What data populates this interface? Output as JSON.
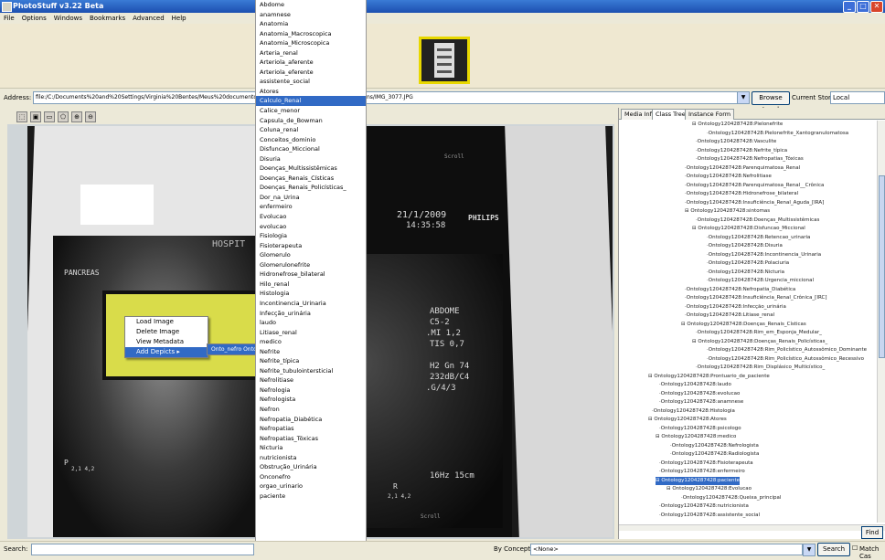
{
  "window": {
    "title": "PhotoStuff v3.22 Beta",
    "controls": [
      "_",
      "□",
      "✕"
    ]
  },
  "menu": [
    "File",
    "Options",
    "Windows",
    "Bookmarks",
    "Advanced",
    "Help"
  ],
  "address": {
    "label": "Address:",
    "value": "file:/C:/Documents%20and%20Settings/Virginia%20Bentes/Meus%20documentos/",
    "value_tail": "ns/IMG_3077.JPG",
    "browse_label": "Browse Local",
    "current_store_label": "Current Store:",
    "current_store_value": "Local"
  },
  "toolbar_icons": [
    "select-tool-icon",
    "image-tool-icon",
    "rect-tool-icon",
    "poly-tool-icon",
    "zoom-in-icon",
    "zoom-out-icon"
  ],
  "toolbar_glyphs": [
    "⬚",
    "▣",
    "▭",
    "⬠",
    "⊕",
    "⊖"
  ],
  "image_text": {
    "hospital": "HOSPIT",
    "pancreas": "PANCREAS",
    "scroll1": "Scroll",
    "scroll2": "Scroll",
    "date": "21/1/2009",
    "time": "14:35:58",
    "brand": "PHILIPS",
    "abdome": "ABDOME",
    "c52": "C5-2",
    "mi": ".MI 1,2",
    "tis": "TIS 0,7",
    "h2": "H2  Gn 74",
    "db": "232dB/C4",
    "g": ".G/4/3",
    "hz": "16Hz  15cm",
    "pr1": "P",
    "pr2": "R",
    "val1": "2,1  4,2",
    "val2": "2,1  4,2"
  },
  "context_menu": {
    "items": [
      "Load Image",
      "Delete Image",
      "View Metadata",
      "Add Depicts"
    ],
    "submenu": "Onto_nefro Ontology"
  },
  "dropdown_items": [
    "Abdome",
    "anamnese",
    "Anatomia",
    "Anatomia_Macroscopica",
    "Anatomia_Microscopica",
    "Arteria_renal",
    "Arteriola_aferente",
    "Arteriola_eferente",
    "assistente_social",
    "Atores",
    "Calculo_Renal",
    "Calice_menor",
    "Capsula_de_Bowman",
    "Coluna_renal",
    "Conceitos_dominio",
    "Disfuncao_Miccional",
    "Disuria",
    "Doenças_Multissistêmicas",
    "Doenças_Renais_Císticas",
    "Doenças_Renais_Policísticas_",
    "Dor_na_Urina",
    "enfermeiro",
    "Evolucao",
    "evolucao",
    "Fisiologia",
    "Fisioterapeuta",
    "Glomerulo",
    "Glomerulonefrite",
    "Hidronefrose_bilateral",
    "Hilo_renal",
    "Histologia",
    "Incontinencia_Urinaria",
    "Infecção_urinária",
    "laudo",
    "Litiase_renal",
    "medico",
    "Nefrite",
    "Nefrite_típica",
    "Nefrite_tubulointersticial",
    "Nefrolitiase",
    "Nefrologia",
    "Nefrologista",
    "Nefron",
    "Nefropatia_Diabética",
    "Nefropatias",
    "Nefropatias_Tóxicas",
    "Nicturia",
    "nutricionista",
    "Obstrução_Urinária",
    "Onconefro",
    "orgao_urinario",
    "paciente"
  ],
  "selected_dropdown": "Calculo_Renal",
  "tabs": [
    "Media Info",
    "Class Tree",
    "Instance Form"
  ],
  "tree_items": [
    {
      "i": 80,
      "t": "⊟ Ontology1204287428:Pielonefrite"
    },
    {
      "i": 96,
      "t": "·Ontology1204287428:Pielonefrite_Xantogranulomatosa"
    },
    {
      "i": 84,
      "t": "·Ontology1204287428:Vasculite"
    },
    {
      "i": 84,
      "t": "·Ontology1204287428:Nefrite_típica"
    },
    {
      "i": 84,
      "t": "·Ontology1204287428:Nefropatias_Tóxicas"
    },
    {
      "i": 72,
      "t": "·Ontology1204287428:Parenquimatosa_Renal"
    },
    {
      "i": 72,
      "t": "·Ontology1204287428:Nefrolitiase"
    },
    {
      "i": 72,
      "t": "·Ontology1204287428:Parenquimatosa_Renal__Crônica"
    },
    {
      "i": 72,
      "t": "·Ontology1204287428:Hidronefrose_bilateral"
    },
    {
      "i": 72,
      "t": "·Ontology1204287428:Insuficiência_Renal_Aguda_[IRA]"
    },
    {
      "i": 72,
      "t": "⊟ Ontology1204287428:sintomas"
    },
    {
      "i": 84,
      "t": "·Ontology1204287428:Doenças_Multissistêmicas"
    },
    {
      "i": 80,
      "t": "⊟ Ontology1204287428:Disfuncao_Miccional"
    },
    {
      "i": 96,
      "t": "·Ontology1204287428:Retencao_urinaria"
    },
    {
      "i": 96,
      "t": "·Ontology1204287428:Disuria"
    },
    {
      "i": 96,
      "t": "·Ontology1204287428:Incontinencia_Urinaria"
    },
    {
      "i": 96,
      "t": "·Ontology1204287428:Polaciuria"
    },
    {
      "i": 96,
      "t": "·Ontology1204287428:Nicturia"
    },
    {
      "i": 96,
      "t": "·Ontology1204287428:Urgencia_miccional"
    },
    {
      "i": 72,
      "t": "·Ontology1204287428:Nefropatia_Diabética"
    },
    {
      "i": 72,
      "t": "·Ontology1204287428:Insuficiência_Renal_Crônica_[IRC]"
    },
    {
      "i": 72,
      "t": "·Ontology1204287428:Infecção_urinária"
    },
    {
      "i": 72,
      "t": "·Ontology1204287428:Litiase_renal"
    },
    {
      "i": 68,
      "t": "⊟ Ontology1204287428:Doenças_Renais_Císticas"
    },
    {
      "i": 84,
      "t": "·Ontology1204287428:Rim_em_Esponja_Medular_"
    },
    {
      "i": 80,
      "t": "⊟ Ontology1204287428:Doenças_Renais_Policísticas_"
    },
    {
      "i": 96,
      "t": "·Ontology1204287428:Rim_Policístico_Autossômico_Dominante"
    },
    {
      "i": 96,
      "t": "·Ontology1204287428:Rim_Policístico_Autossômico_Recessivo"
    },
    {
      "i": 84,
      "t": "·Ontology1204287428:Rim_Displásico_Multicístico_"
    },
    {
      "i": 32,
      "t": "⊟ Ontology1204287428:Prontuario_de_paciente"
    },
    {
      "i": 44,
      "t": "·Ontology1204287428:laudo"
    },
    {
      "i": 44,
      "t": "·Ontology1204287428:evolucao"
    },
    {
      "i": 44,
      "t": "·Ontology1204287428:anamnese"
    },
    {
      "i": 36,
      "t": "·Ontology1204287428:Histologia"
    },
    {
      "i": 32,
      "t": "⊟ Ontology1204287428:Atores"
    },
    {
      "i": 44,
      "t": "·Ontology1204287428:psicologo"
    },
    {
      "i": 40,
      "t": "⊟ Ontology1204287428:medico"
    },
    {
      "i": 56,
      "t": "·Ontology1204287428:Nefrologista"
    },
    {
      "i": 56,
      "t": "·Ontology1204287428:Radiologista"
    },
    {
      "i": 44,
      "t": "·Ontology1204287428:Fisioterapeuta"
    },
    {
      "i": 44,
      "t": "·Ontology1204287428:enfermeiro"
    },
    {
      "i": 40,
      "t": "⊟ Ontology1204287428:paciente",
      "sel": true
    },
    {
      "i": 52,
      "t": "⊟ Ontology1204287428:Evolucao"
    },
    {
      "i": 68,
      "t": "·Ontology1204287428:Queixa_principal"
    },
    {
      "i": 44,
      "t": "·Ontology1204287428:nutricionista"
    },
    {
      "i": 44,
      "t": "·Ontology1204287428:assistente_social"
    }
  ],
  "find_label": "Find",
  "bottom": {
    "search_label": "Search:",
    "concept_label": "By Concept:",
    "concept_value": "<None>",
    "search_button": "Search",
    "match_label": "Match Cas"
  },
  "colors": {
    "selection": "#316ac5",
    "titlebar": "#1c4fb0",
    "yellow_region": "#d9dc4a"
  }
}
